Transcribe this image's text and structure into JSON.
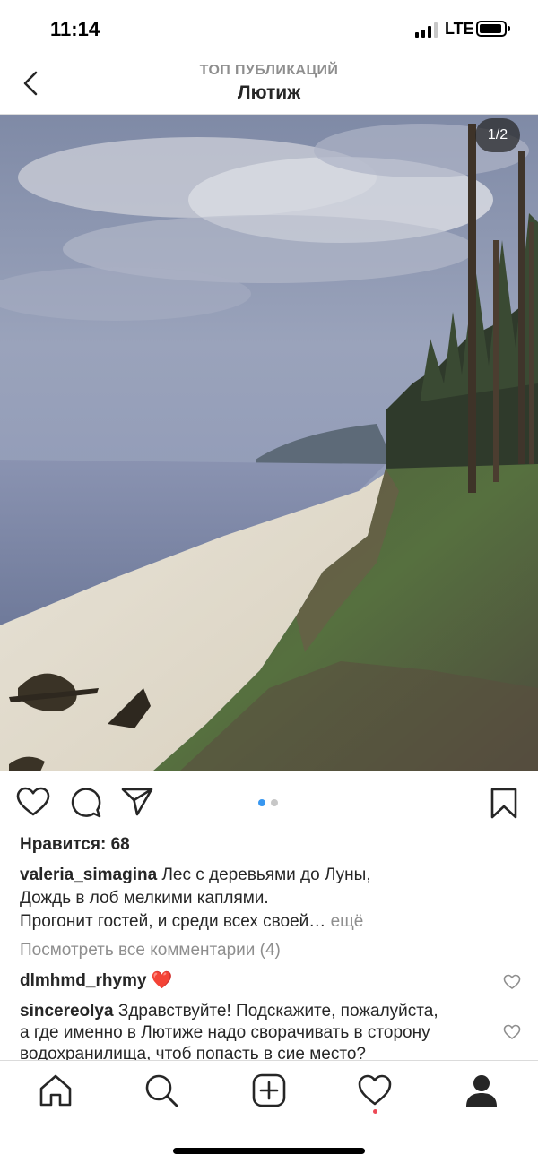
{
  "status_bar": {
    "time": "11:14",
    "network": "LTE",
    "signal_bars_active": 3,
    "signal_bars_total": 4
  },
  "nav": {
    "subtitle": "ТОП ПУБЛИКАЦИЙ",
    "title": "Лютиж",
    "back_icon": "chevron-left-icon"
  },
  "post": {
    "image_counter": "1/2",
    "current_slide": 1,
    "total_slides": 2,
    "likes": "Нравится: 68",
    "caption": {
      "username": "valeria_simagina",
      "line1": "Лес с деревьями до Луны,",
      "line2": "Дождь в лоб мелкими каплями.",
      "line3": "Прогонит гостей, и среди всех своей…",
      "more": "ещё"
    },
    "view_all_comments": "Посмотреть все комментарии (4)",
    "comments": [
      {
        "username": "dlmhmd_rhymy",
        "text": "❤️"
      },
      {
        "username": "sincereolya",
        "text": "Здравствуйте! Подскажите, пожалуйста,",
        "line2": "а где именно в Лютиже надо сворачивать в сторону",
        "line3": "водохранилища, чтоб попасть в сие место?"
      }
    ]
  },
  "colors": {
    "accent_blue": "#3897f0",
    "dot_inactive": "#c7c7c7",
    "muted_text": "#8e8e8e",
    "notification_red": "#ed4956"
  },
  "icons": {
    "actions": [
      "heart-icon",
      "comment-icon",
      "share-icon",
      "bookmark-icon"
    ],
    "tabs": [
      "home-icon",
      "search-icon",
      "add-post-icon",
      "activity-heart-icon",
      "profile-icon"
    ]
  }
}
